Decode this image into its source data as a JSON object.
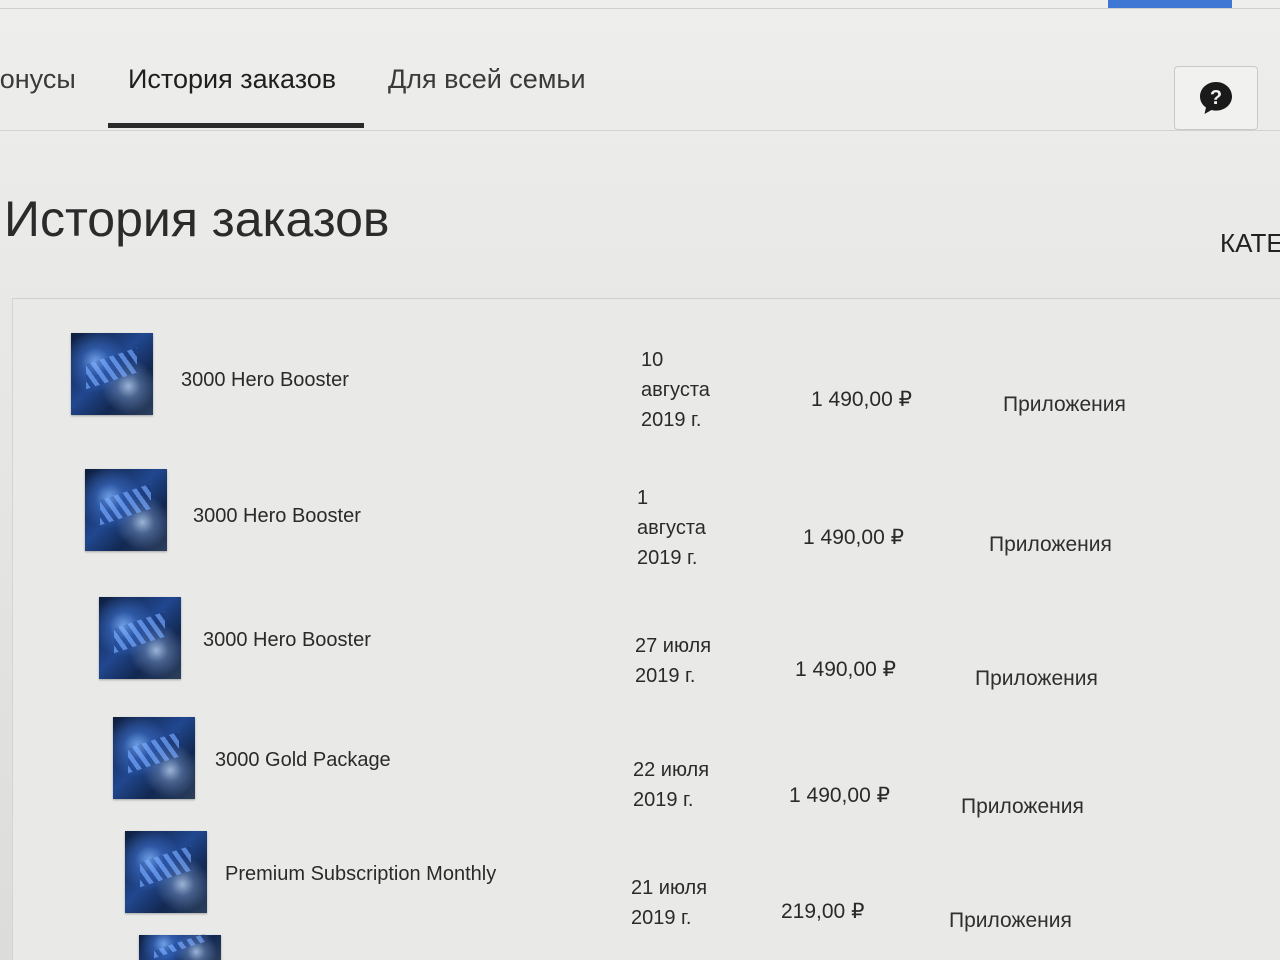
{
  "tabs": [
    {
      "label": "Бонусы",
      "active": false
    },
    {
      "label": "История заказов",
      "active": true
    },
    {
      "label": "Для всей семьи",
      "active": false
    }
  ],
  "help_icon": "question-mark-bubble-icon",
  "page_title": "История заказов",
  "category_header": "КАТЕ",
  "colors": {
    "accent": "#3f77d4",
    "tab_underline": "#2a2a2a",
    "background": "#e7e8e6"
  },
  "orders": [
    {
      "name": "3000 Hero Booster",
      "date_line1": "10",
      "date_line2": "августа",
      "date_line3": "2019 г.",
      "price": "1 490,00 ₽",
      "category": "Приложения"
    },
    {
      "name": "3000 Hero Booster",
      "date_line1": "1",
      "date_line2": "августа",
      "date_line3": "2019 г.",
      "price": "1 490,00 ₽",
      "category": "Приложения"
    },
    {
      "name": "3000 Hero Booster",
      "date_line1": "27 июля",
      "date_line2": "2019 г.",
      "date_line3": "",
      "price": "1 490,00 ₽",
      "category": "Приложения"
    },
    {
      "name": "3000 Gold Package",
      "date_line1": "22 июля",
      "date_line2": "2019 г.",
      "date_line3": "",
      "price": "1 490,00 ₽",
      "category": "Приложения"
    },
    {
      "name": "Premium Subscription Monthly",
      "date_line1": "21 июля",
      "date_line2": "2019 г.",
      "date_line3": "",
      "price": "219,00 ₽",
      "category": "Приложения"
    }
  ]
}
